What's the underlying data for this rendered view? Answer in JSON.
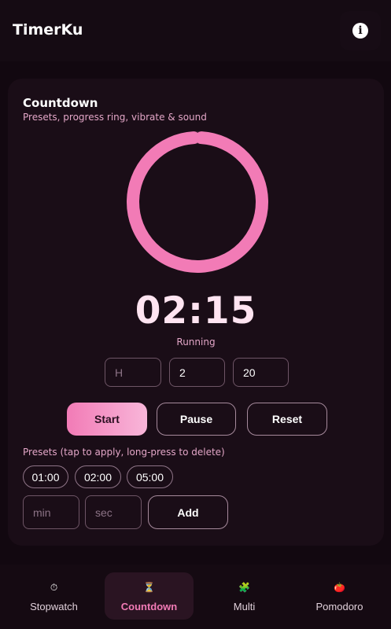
{
  "app": {
    "title": "TimerKu"
  },
  "countdown": {
    "title": "Countdown",
    "subtitle": "Presets, progress ring, vibrate & sound",
    "time": "02:15",
    "status": "Running",
    "progress": 0.98,
    "inputs": {
      "hours": {
        "value": "",
        "placeholder": "H"
      },
      "minutes": {
        "value": "2",
        "placeholder": ""
      },
      "seconds": {
        "value": "20",
        "placeholder": ""
      }
    },
    "buttons": {
      "start": "Start",
      "pause": "Pause",
      "reset": "Reset"
    },
    "presets_label": "Presets (tap to apply, long-press to delete)",
    "presets": [
      "01:00",
      "02:00",
      "05:00"
    ],
    "new_preset": {
      "min_placeholder": "min",
      "sec_placeholder": "sec",
      "add_label": "Add"
    }
  },
  "nav": {
    "items": [
      {
        "label": "Stopwatch",
        "icon": "⏱",
        "icon_name": "stopwatch-icon"
      },
      {
        "label": "Countdown",
        "icon": "⏳",
        "icon_name": "hourglass-icon",
        "active": true
      },
      {
        "label": "Multi",
        "icon": "🧩",
        "icon_name": "puzzle-icon"
      },
      {
        "label": "Pomodoro",
        "icon": "🍅",
        "icon_name": "tomato-icon"
      }
    ]
  },
  "colors": {
    "accent": "#f27bb6",
    "background": "#120810",
    "card": "#1a0d17",
    "muted_text": "#e3a6c7"
  }
}
